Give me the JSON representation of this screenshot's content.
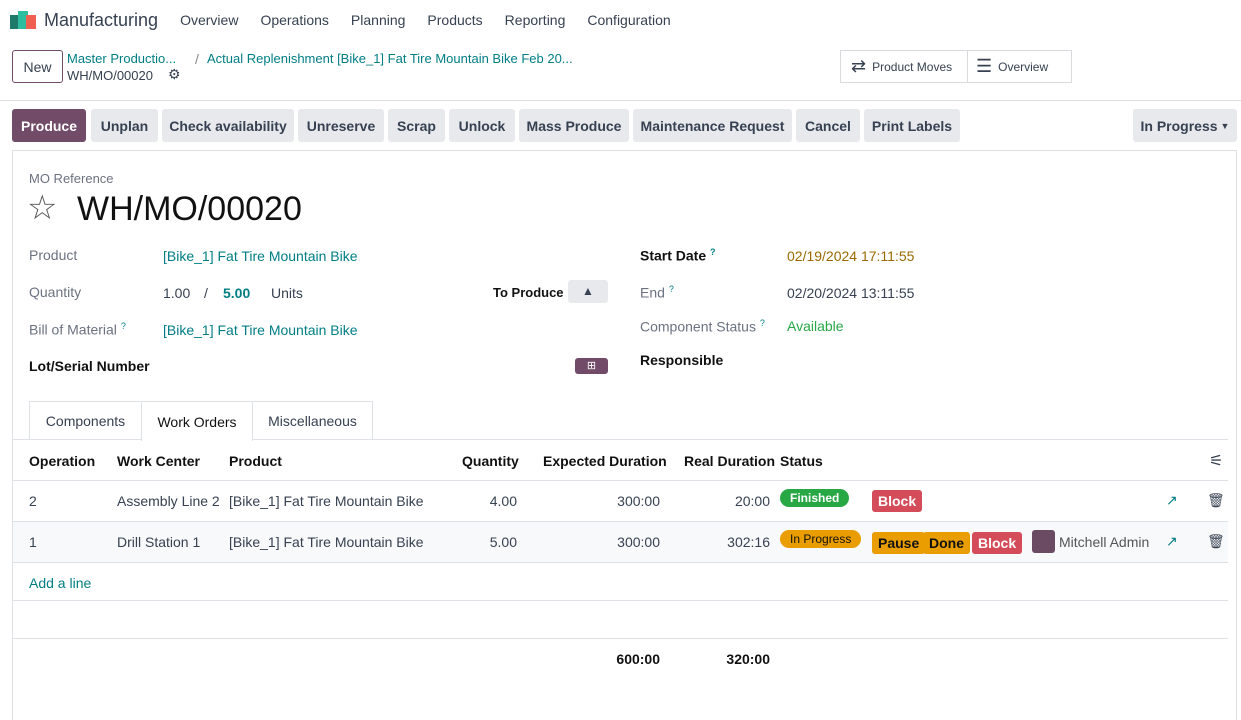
{
  "nav": {
    "app": "Manufacturing",
    "menus": [
      "Overview",
      "Operations",
      "Planning",
      "Products",
      "Reporting",
      "Configuration"
    ]
  },
  "breadcrumb": {
    "new": "New",
    "crumb1": "Master Productio...",
    "crumb2": "Actual Replenishment [Bike_1] Fat Tire Mountain Bike Feb 20...",
    "current": "WH/MO/00020"
  },
  "smart_buttons": {
    "moves": "Product Moves",
    "overview": "Overview"
  },
  "actions": [
    "Produce",
    "Unplan",
    "Check availability",
    "Unreserve",
    "Scrap",
    "Unlock",
    "Mass Produce",
    "Maintenance Request",
    "Cancel",
    "Print Labels"
  ],
  "status": "In Progress",
  "form": {
    "ref_label": "MO Reference",
    "ref": "WH/MO/00020",
    "product_label": "Product",
    "product": "[Bike_1] Fat Tire Mountain Bike",
    "qty_label": "Quantity",
    "qty_done": "1.00",
    "slash": "/",
    "qty_total": "5.00",
    "uom": "Units",
    "to_produce": "To Produce",
    "bom_label": "Bill of Material",
    "bom": "[Bike_1] Fat Tire Mountain Bike",
    "lot_label": "Lot/Serial Number",
    "start_label": "Start Date",
    "start": "02/19/2024 17:11:55",
    "end_label": "End",
    "end": "02/20/2024 13:11:55",
    "comp_label": "Component Status",
    "comp": "Available",
    "resp_label": "Responsible"
  },
  "tabs": [
    "Components",
    "Work Orders",
    "Miscellaneous"
  ],
  "table": {
    "headers": [
      "Operation",
      "Work Center",
      "Product",
      "Quantity",
      "Expected Duration",
      "Real Duration",
      "Status"
    ],
    "rows": [
      {
        "op": "2",
        "wc": "Assembly Line 2",
        "product": "[Bike_1] Fat Tire Mountain Bike",
        "qty": "4.00",
        "exp": "300:00",
        "real": "20:00",
        "status": "Finished",
        "buttons": [
          "Block"
        ],
        "user": ""
      },
      {
        "op": "1",
        "wc": "Drill Station 1",
        "product": "[Bike_1] Fat Tire Mountain Bike",
        "qty": "5.00",
        "exp": "300:00",
        "real": "302:16",
        "status": "In Progress",
        "buttons": [
          "Pause",
          "Done",
          "Block"
        ],
        "user": "Mitchell Admin"
      }
    ],
    "add_line": "Add a line",
    "total_exp": "600:00",
    "total_real": "320:00"
  },
  "colors": {
    "primary": "#714b67",
    "link": "#017e84",
    "finished": "#28a745",
    "progress": "#e99d00",
    "block": "#d44c59"
  }
}
